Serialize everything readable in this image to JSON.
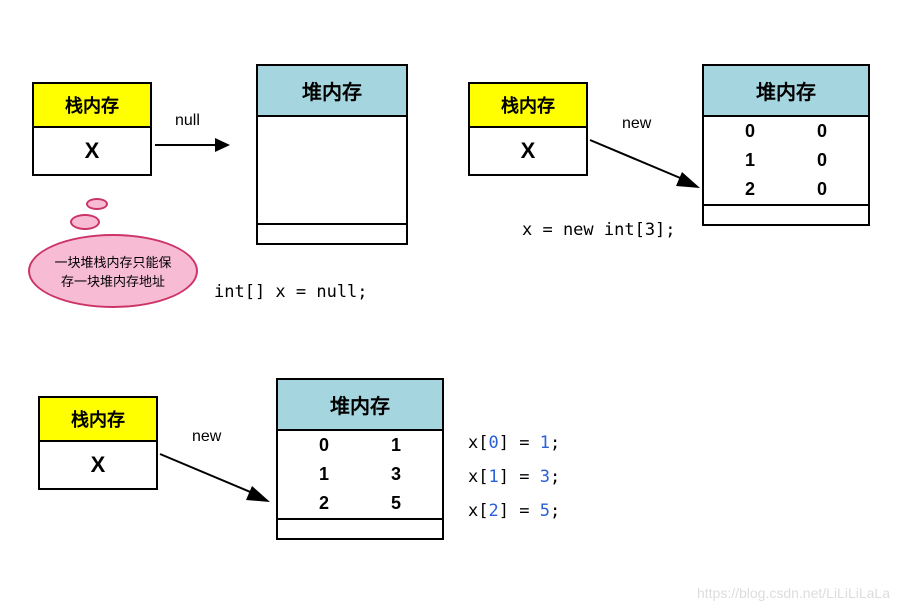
{
  "labels": {
    "stack": "栈内存",
    "heap": "堆内存",
    "x": "X",
    "null": "null",
    "new": "new"
  },
  "note": {
    "line1": "一块堆栈内存只能保",
    "line2": "存一块堆内存地址"
  },
  "code": {
    "decl": "int[] x = null;",
    "stmt2": "x = new int[3];",
    "a0_pre": "x[",
    "a0_idx": "0",
    "a0_mid": "] = ",
    "a0_val": "1",
    "a0_end": ";",
    "a1_pre": "x[",
    "a1_idx": "1",
    "a1_mid": "] = ",
    "a1_val": "3",
    "a1_end": ";",
    "a2_pre": "x[",
    "a2_idx": "2",
    "a2_mid": "] = ",
    "a2_val": "5",
    "a2_end": ";"
  },
  "heap2": {
    "r0i": "0",
    "r0v": "0",
    "r1i": "1",
    "r1v": "0",
    "r2i": "2",
    "r2v": "0"
  },
  "heap3": {
    "r0i": "0",
    "r0v": "1",
    "r1i": "1",
    "r1v": "3",
    "r2i": "2",
    "r2v": "5"
  },
  "watermark": "https://blog.csdn.net/LiLiLiLaLa"
}
